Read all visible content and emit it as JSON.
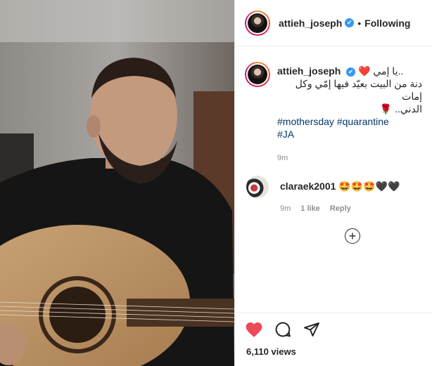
{
  "post": {
    "author": "attieh_joseph",
    "follow_status": "Following",
    "separator": "•",
    "verified_mark": "✔",
    "caption_line1": "..يا إمي ❤️",
    "caption_line2": "دنة من البيت بعيّد فيها إمّي وكل إمات",
    "caption_line3": "الدني.. 🌹",
    "hashtags_line1": "#mothersday #quarantine",
    "hashtags_line2": "#JA",
    "caption_time": "9m"
  },
  "comment": {
    "author": "claraek2001",
    "text": "🤩🤩🤩🖤🖤",
    "time": "9m",
    "likes": "1 like",
    "reply": "Reply"
  },
  "load_more_symbol": "+",
  "footer": {
    "views": "6,110 views"
  },
  "icons": {
    "like": "heart-filled-icon",
    "comment": "comment-icon",
    "share": "share-icon",
    "load_more": "plus-circle-icon",
    "verified": "verified-badge-icon"
  },
  "colors": {
    "heart": "#ed4956",
    "hashtag": "#00376b",
    "verified": "#3897f0",
    "secondary_text": "#8e8e8e"
  }
}
